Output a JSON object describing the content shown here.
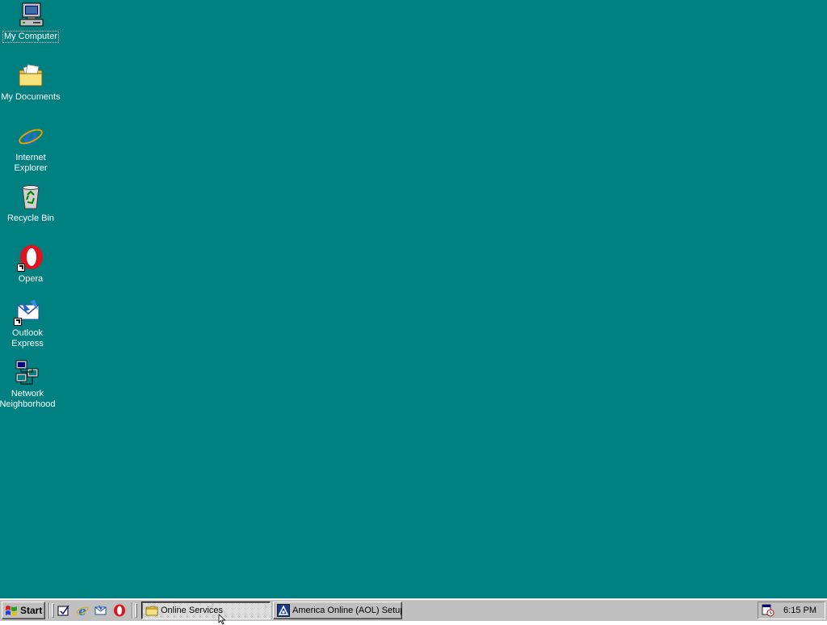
{
  "desktop": {
    "background_color": "#008080",
    "icons": [
      {
        "label": "My Computer",
        "icon": "my-computer-icon",
        "selected": true
      },
      {
        "label": "My Documents",
        "icon": "folder-documents-icon"
      },
      {
        "label": "Internet Explorer",
        "icon": "internet-explorer-icon"
      },
      {
        "label": "Recycle Bin",
        "icon": "recycle-bin-icon"
      },
      {
        "label": "Opera",
        "icon": "opera-icon",
        "shortcut": true
      },
      {
        "label": "Outlook Express",
        "icon": "outlook-express-icon",
        "shortcut": true
      },
      {
        "label": "Network Neighborhood",
        "icon": "network-neighborhood-icon"
      }
    ]
  },
  "taskbar": {
    "start_label": "Start",
    "quick_launch": [
      {
        "icon": "show-desktop-icon"
      },
      {
        "icon": "internet-explorer-icon"
      },
      {
        "icon": "outlook-express-icon"
      },
      {
        "icon": "opera-icon"
      }
    ],
    "tasks": [
      {
        "label": "Online Services",
        "icon": "folder-icon",
        "active": true
      },
      {
        "label": "America Online (AOL) Setup",
        "icon": "aol-setup-icon",
        "active": false
      }
    ],
    "tray": {
      "icons": [
        "scheduler-icon"
      ],
      "clock": "6:15 PM"
    }
  }
}
